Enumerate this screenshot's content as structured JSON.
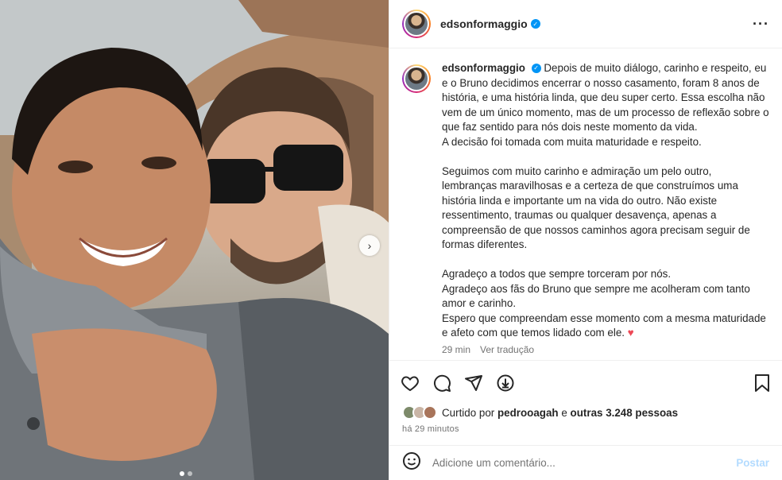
{
  "post": {
    "username": "edsonformaggio",
    "verified": true,
    "caption_paragraphs": [
      [
        "Depois de muito diálogo, carinho e respeito, eu e o Bruno decidimos encerrar o nosso casamento, foram 8 anos de história, e uma história linda, que deu super certo. Essa escolha não vem de um único momento, mas de um processo de reflexão sobre o que faz sentido para nós dois neste momento da vida.",
        "A decisão foi tomada com muita maturidade e respeito."
      ],
      [
        "Seguimos com muito carinho e admiração um pelo outro, lembranças maravilhosas e a certeza de que construímos uma história linda e importante um na vida do outro. Não existe ressentimento, traumas ou qualquer desavença, apenas a compreensão de que nossos caminhos agora precisam seguir de formas diferentes."
      ],
      [
        "Agradeço a todos que sempre torceram por nós.",
        "Agradeço aos fãs do Bruno que sempre me acolheram com tanto amor e carinho.",
        "Espero que compreendam esse momento com a mesma maturidade e afeto com que temos lidado com ele."
      ]
    ],
    "caption_emoji": "♥",
    "time": "29 min",
    "translate_label": "Ver tradução",
    "likes": {
      "prefix": "Curtido por",
      "user": "pedrooagah",
      "connector": "e",
      "others": "outras 3.248 pessoas"
    },
    "posted_ago": "há 29 minutos",
    "comment": {
      "placeholder": "Adicione um comentário...",
      "post_label": "Postar"
    },
    "carousel": {
      "count": 2,
      "active": 0
    }
  },
  "colors": {
    "verified": "#0095f6",
    "heart": "#ed4956",
    "post_button": "#b3dbff",
    "muted_text": "#737373"
  },
  "icons": [
    "more-options-icon",
    "like-icon",
    "comment-icon",
    "share-icon",
    "repost-icon",
    "save-icon",
    "emoji-icon",
    "carousel-next-icon"
  ]
}
